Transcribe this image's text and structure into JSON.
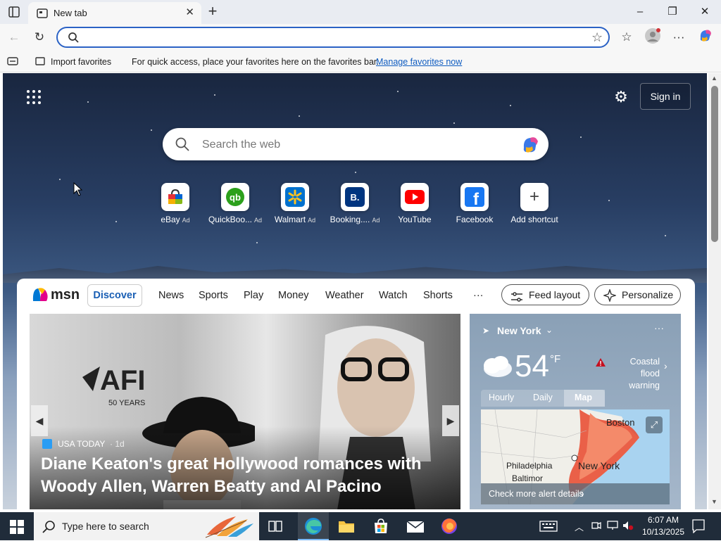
{
  "browser": {
    "tab_title": "New tab",
    "address_value": "",
    "favbar": {
      "import_label": "Import favorites",
      "message": "For quick access, place your favorites here on the favorites bar.",
      "manage_link": "Manage favorites now"
    }
  },
  "newtab": {
    "signin_label": "Sign in",
    "search_placeholder": "Search the web",
    "shortcuts": [
      {
        "label": "eBay",
        "ad": "Ad",
        "color": "#e53238"
      },
      {
        "label": "QuickBoo...",
        "ad": "Ad",
        "color": "#2ca01c"
      },
      {
        "label": "Walmart",
        "ad": "Ad",
        "color": "#0071ce"
      },
      {
        "label": "Booking....",
        "ad": "Ad",
        "color": "#003580"
      },
      {
        "label": "YouTube",
        "ad": "",
        "color": "#ff0000"
      },
      {
        "label": "Facebook",
        "ad": "",
        "color": "#1877f2"
      },
      {
        "label": "Add shortcut",
        "ad": "",
        "color": "#444444"
      }
    ]
  },
  "msn": {
    "logo": "msn",
    "nav": [
      "Discover",
      "News",
      "Sports",
      "Play",
      "Money",
      "Weather",
      "Watch",
      "Shorts"
    ],
    "more": "···",
    "feed_layout": "Feed layout",
    "personalize": "Personalize",
    "hero": {
      "source": "USA TODAY",
      "age": "· 1d",
      "headline": "Diane Keaton's great Hollywood romances with Woody Allen, Warren Beatty and Al Pacino"
    },
    "weather": {
      "city": "New York",
      "temp": "54",
      "unit": "°F",
      "alert": "Coastal flood warning",
      "tabs": [
        "Hourly",
        "Daily",
        "Map"
      ],
      "map_labels": [
        "Boston",
        "Philadelphia",
        "Baltimor",
        "New York"
      ],
      "alert_link": "Check more alert details"
    }
  },
  "taskbar": {
    "search_placeholder": "Type here to search",
    "time": "6:07 AM",
    "date": "10/13/2025"
  }
}
